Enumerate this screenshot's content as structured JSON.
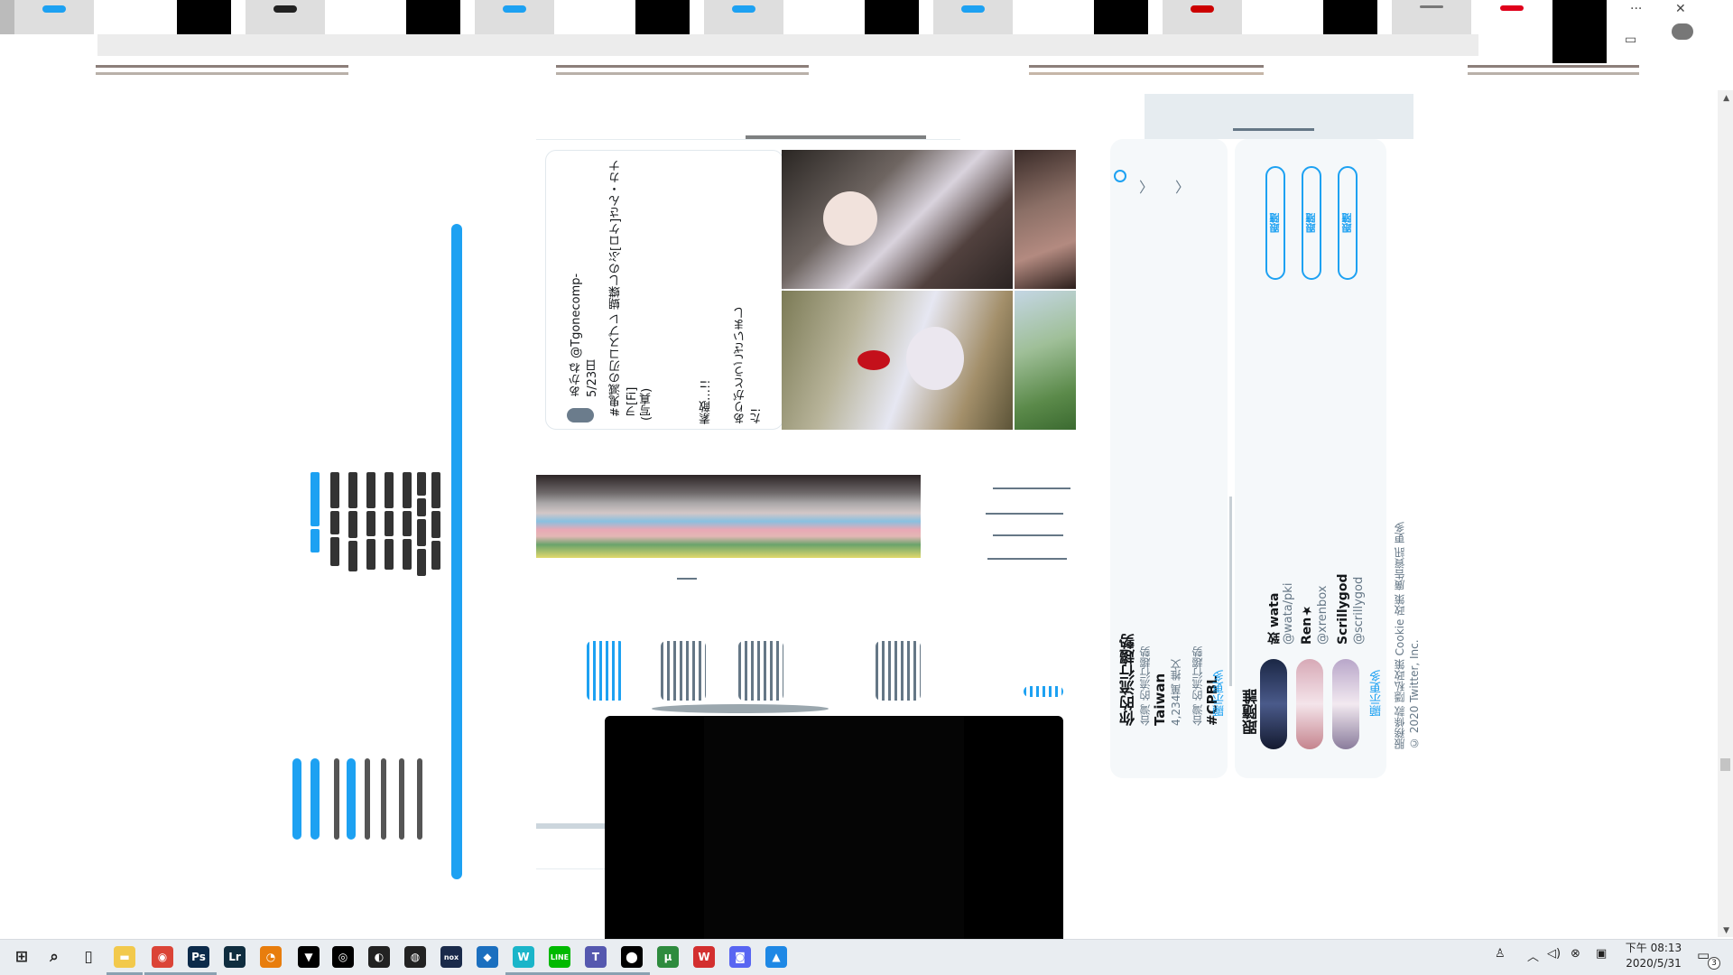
{
  "browser": {
    "window_controls": {
      "more": "···",
      "close": "✕",
      "restore": "▭"
    }
  },
  "tweet": {
    "user_line": "あかね @Tgonecomp-5/23日",
    "body_line1": "#鬼滅の刃コスプレ 蝴蝶しのぶ[ロケ]さん・カナヲ[Fi]",
    "body_line2": "(写真)",
    "body_line3": "素敵…!!",
    "body_line4": "ありがとうございました!"
  },
  "trends": {
    "title": "你的流行趨勢",
    "item_location": "台灣 的流行趨勢",
    "item_name": "Taiwan",
    "item_count": "4,234萬 推文",
    "item2_location": "台灣 的流行趨勢",
    "item2_name": "#CPBL",
    "show_more": "顯示更多"
  },
  "follow": {
    "title": "跟隨誰",
    "users": [
      {
        "name": "致 wata",
        "handle": "@wata/pki",
        "button": "跟隨"
      },
      {
        "name": "Ren★",
        "handle": "@xrenbox",
        "button": "跟隨"
      },
      {
        "name": "Scrillygod",
        "handle": "@scrillygod",
        "button": "跟隨"
      }
    ],
    "show_more": "顯示更多"
  },
  "footer": {
    "line1": "服務條款  隱私政策  Cookie 政策  廣告資訊  更多",
    "line2": "© 2020 Twitter, Inc."
  },
  "taskbar": {
    "icons": [
      {
        "name": "windows-start-icon",
        "glyph": "⊞",
        "color": "#000000"
      },
      {
        "name": "search-icon",
        "glyph": "⌕",
        "color": "#000000"
      },
      {
        "name": "task-view-icon",
        "glyph": "▯",
        "color": "#000000"
      },
      {
        "name": "file-explorer-icon",
        "glyph": "▬",
        "color": "#f2c94c"
      },
      {
        "name": "chrome-icon",
        "glyph": "◉",
        "color": "#db4437"
      },
      {
        "name": "photoshop-icon",
        "glyph": "Ps",
        "color": "#0b2a4a"
      },
      {
        "name": "lightroom-icon",
        "glyph": "Lr",
        "color": "#0f2d3f"
      },
      {
        "name": "blender-icon",
        "glyph": "◔",
        "color": "#e87d0d"
      },
      {
        "name": "fox-icon",
        "glyph": "▼",
        "color": "#000000"
      },
      {
        "name": "ubisoft-icon",
        "glyph": "◎",
        "color": "#000000"
      },
      {
        "name": "app-icon",
        "glyph": "◐",
        "color": "#222222"
      },
      {
        "name": "obs-icon",
        "glyph": "◍",
        "color": "#222222"
      },
      {
        "name": "nox-icon",
        "glyph": "nox",
        "color": "#1a2a4a"
      },
      {
        "name": "bot-icon",
        "glyph": "◆",
        "color": "#1b6fbf"
      },
      {
        "name": "w-icon",
        "glyph": "W",
        "color": "#1ab5c9"
      },
      {
        "name": "line-icon",
        "glyph": "LINE",
        "color": "#00b900"
      },
      {
        "name": "teams-icon",
        "glyph": "T",
        "color": "#5558af"
      },
      {
        "name": "steam-icon",
        "glyph": "⬤",
        "color": "#000000"
      },
      {
        "name": "utorrent-icon",
        "glyph": "μ",
        "color": "#2e8b3e"
      },
      {
        "name": "wps-icon",
        "glyph": "W",
        "color": "#d32f2f"
      },
      {
        "name": "discord-icon",
        "glyph": "◙",
        "color": "#5865f2"
      },
      {
        "name": "photos-icon",
        "glyph": "▲",
        "color": "#1e88e5"
      }
    ],
    "clock_time": "下午 08:13",
    "clock_date": "2020/5/31",
    "notification_count": "3"
  }
}
